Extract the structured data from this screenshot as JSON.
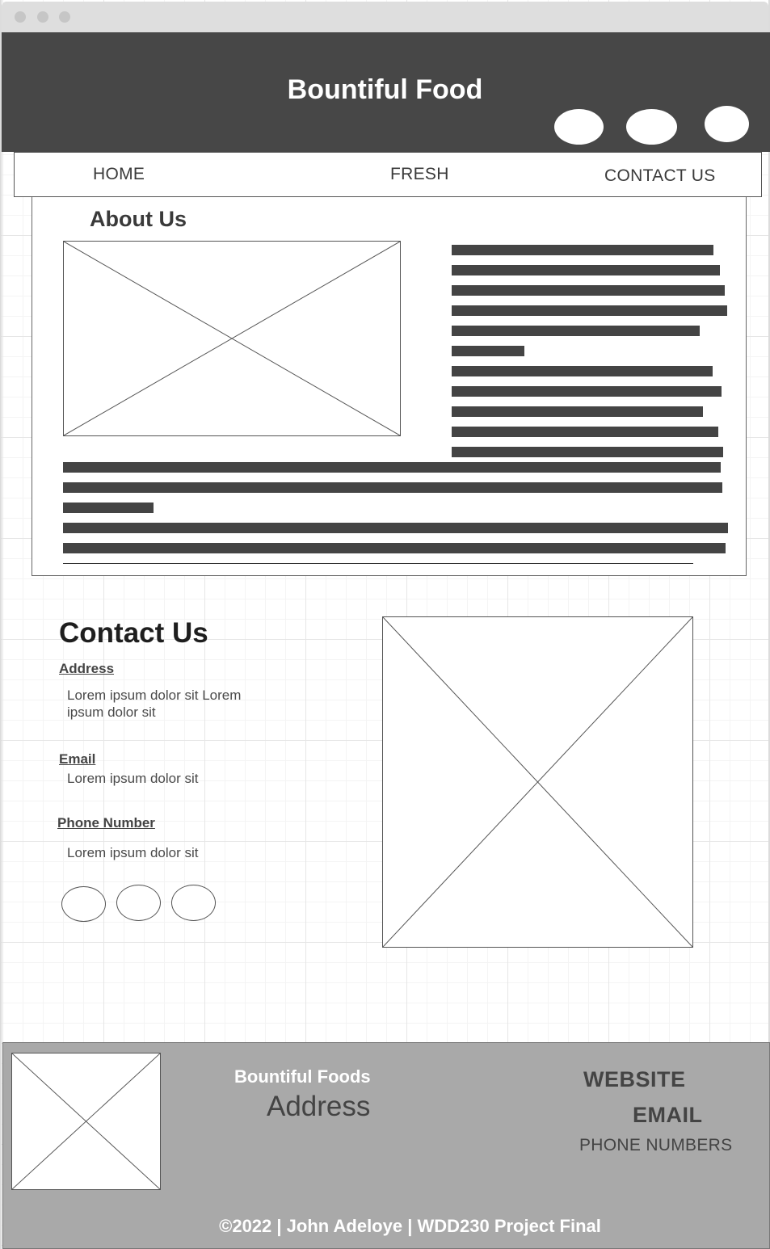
{
  "header": {
    "title": "Bountiful Food",
    "social_icons": [
      "social-icon-1",
      "social-icon-2",
      "social-icon-3"
    ]
  },
  "nav": {
    "items": [
      {
        "label": "HOME"
      },
      {
        "label": "FRESH"
      },
      {
        "label": "CONTACT US"
      }
    ]
  },
  "about": {
    "title": "About Us"
  },
  "contact": {
    "title": "Contact Us",
    "address_label": "Address",
    "address_value": "Lorem ipsum dolor sit Lorem ipsum dolor sit",
    "email_label": "Email",
    "email_value": "Lorem ipsum dolor sit",
    "phone_label": "Phone Number",
    "phone_value": "Lorem ipsum dolor sit"
  },
  "footer": {
    "brand": "Bountiful Foods",
    "address": "Address",
    "website": "WEBSITE",
    "email": "EMAIL",
    "phone": "PHONE NUMBERS",
    "copyright": "©2022 | John Adeloye | WDD230 Project Final"
  },
  "colors": {
    "header_bg": "#474747",
    "footer_bg": "#a9a9a9",
    "text_bar": "#444444"
  }
}
